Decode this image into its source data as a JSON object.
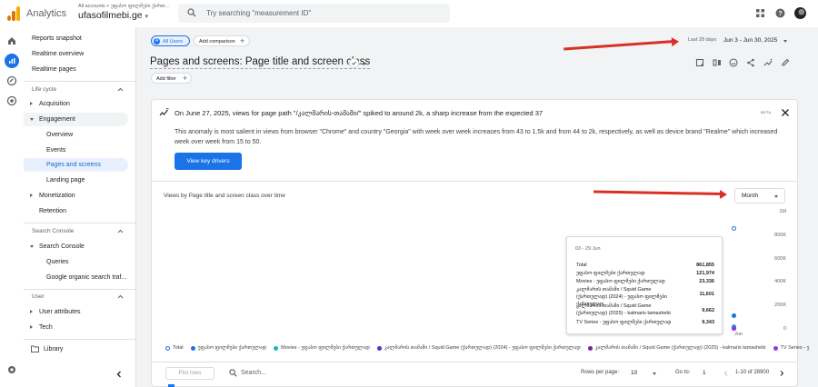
{
  "app": {
    "name": "Analytics",
    "account_crumb": "All accounts > უფასო ფილმები ქართ...",
    "property": "ufasofilmebi.ge",
    "search_placeholder": "Try searching \"measurement ID\""
  },
  "sidebar": {
    "items": [
      {
        "label": "Reports snapshot"
      },
      {
        "label": "Realtime overview"
      },
      {
        "label": "Realtime pages"
      }
    ],
    "lifecycle_title": "Life cycle",
    "lifecycle": [
      {
        "label": "Acquisition"
      },
      {
        "label": "Engagement"
      },
      {
        "label": "Overview"
      },
      {
        "label": "Events"
      },
      {
        "label": "Pages and screens"
      },
      {
        "label": "Landing page"
      },
      {
        "label": "Monetization"
      },
      {
        "label": "Retention"
      }
    ],
    "search_console_title": "Search Console",
    "search_console": [
      {
        "label": "Search Console"
      },
      {
        "label": "Queries"
      },
      {
        "label": "Google organic search traf..."
      }
    ],
    "user_title": "User",
    "user": [
      {
        "label": "User attributes"
      },
      {
        "label": "Tech"
      }
    ],
    "library": "Library"
  },
  "header": {
    "all_users": "All Users",
    "all_users_badge": "A",
    "add_comparison": "Add comparison",
    "date_label": "Last 28 days",
    "date_range": "Jun 3 - Jun 30, 2025",
    "title": "Pages and screens: Page title and screen class",
    "add_filter": "Add filter"
  },
  "insight": {
    "headline": "On June 27, 2025, views for page path \"/კალმარის-თამაში/\" spiked to around 2k, a sharp increase from the expected 37",
    "beta": "BETA",
    "body": "This anomaly is most salient in views from browser \"Chrome\" and country \"Georgia\" with week over week increases from 43 to 1.5k and from 44 to 2k, respectively, as well as device brand \"Realme\" which increased week over week from 15 to 50.",
    "button": "View key drivers"
  },
  "chart_data": {
    "type": "scatter",
    "title": "Views by Page title and screen class over time",
    "granularity": "Month",
    "x": [
      "Jun"
    ],
    "y_ticks": [
      "1M",
      "800K",
      "600K",
      "400K",
      "200K",
      "0"
    ],
    "ylim": [
      0,
      1000000
    ],
    "series": [
      {
        "name": "Total",
        "values": [
          861855
        ],
        "color": "#1a73e8",
        "hollow": true
      },
      {
        "name": "უფასო ფილმები ქართულად",
        "values": [
          121974
        ],
        "color": "#1a73e8"
      },
      {
        "name": "Movies - უფასო ფილმები ქართულად",
        "values": [
          23336
        ],
        "color": "#12b5cb"
      },
      {
        "name": "კალმარის თამაში / Squid Game (ქართულად) (2024) - უფასო ფილმები ქართულად",
        "values": [
          11601
        ],
        "color": "#4539c7"
      },
      {
        "name": "კალმარის თამაში / Squid Game (ქართულად) (2025) - kalmaris tamashebi",
        "values": [
          9662
        ],
        "color": "#7b1fa2"
      },
      {
        "name": "TV Series - უფასო ფილმები ქართულად",
        "values": [
          9343
        ],
        "color": "#9334e6"
      }
    ],
    "tooltip": {
      "date": "03 - 29 Jun",
      "rows": [
        {
          "label": "Total",
          "value": "861,855"
        },
        {
          "label": "უფასო ფილმები ქართულად",
          "value": "121,974"
        },
        {
          "label": "Movies - უფასო ფილმები ქართულად",
          "value": "23,336"
        },
        {
          "label": "კალმარის თამაში / Squid Game (ქართულად) (2024) - უფასო ფილმები ქართულად",
          "value": "11,601"
        },
        {
          "label": "კალმარის თამაში / Squid Game (ქართულად) (2025) - kalmaris tamashebi",
          "value": "9,662"
        },
        {
          "label": "TV Series - უფასო ფილმები ქართულად",
          "value": "9,343"
        }
      ]
    },
    "legend": [
      "Total",
      "უფასო ფილმები ქართულად",
      "Movies - უფასო ფილმები ქართულად",
      "კალმარის თამაში / Squid Game (ქართულად) (2024) - უფასო ფილმები ქართულად",
      "კალმარის თამაში / Squid Game (ქართულად) (2025) - kalmaris tamashebi",
      "TV Series - უ"
    ]
  },
  "table": {
    "plot_rows": "Plot rows",
    "search_placeholder": "Search...",
    "rows_per_page_label": "Rows per page:",
    "rows_per_page": "10",
    "goto_label": "Go to:",
    "goto_value": "1",
    "pagination": "1-10 of 28900"
  },
  "colors": {
    "accent": "#1a73e8",
    "annotation_arrow": "#d93025"
  }
}
